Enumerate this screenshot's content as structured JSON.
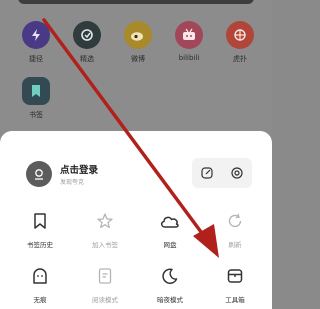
{
  "apps": [
    {
      "label": "捷径",
      "icon": "bolt-icon",
      "color": "#4a3a86"
    },
    {
      "label": "精选",
      "icon": "featured-icon",
      "color": "#2f3b3c"
    },
    {
      "label": "微博",
      "icon": "weibo-icon",
      "color": "#a98a2b"
    },
    {
      "label": "bilibili",
      "icon": "bilibili-icon",
      "color": "#a2475a"
    },
    {
      "label": "虎扑",
      "icon": "hupu-icon",
      "color": "#b0453a"
    },
    {
      "label": "书签",
      "icon": "bookmark-app-icon",
      "color": "#344a52"
    }
  ],
  "account": {
    "title": "点击登录",
    "subtitle": "发现夸克"
  },
  "header_buttons": [
    "edit-icon",
    "settings-icon"
  ],
  "menu": {
    "row1": [
      {
        "label": "书签历史",
        "icon": "bookmark-icon",
        "dim": false
      },
      {
        "label": "加入书签",
        "icon": "star-icon",
        "dim": true
      },
      {
        "label": "网盘",
        "icon": "cloud-icon",
        "dim": false
      },
      {
        "label": "刷新",
        "icon": "refresh-icon",
        "dim": true
      }
    ],
    "row2": [
      {
        "label": "无痕",
        "icon": "ghost-icon",
        "dim": false
      },
      {
        "label": "阅读模式",
        "icon": "reader-icon",
        "dim": true
      },
      {
        "label": "暗夜模式",
        "icon": "moon-icon",
        "dim": false
      },
      {
        "label": "工具箱",
        "icon": "toolbox-icon",
        "dim": false
      }
    ]
  },
  "annotation_color": "#b0211b"
}
